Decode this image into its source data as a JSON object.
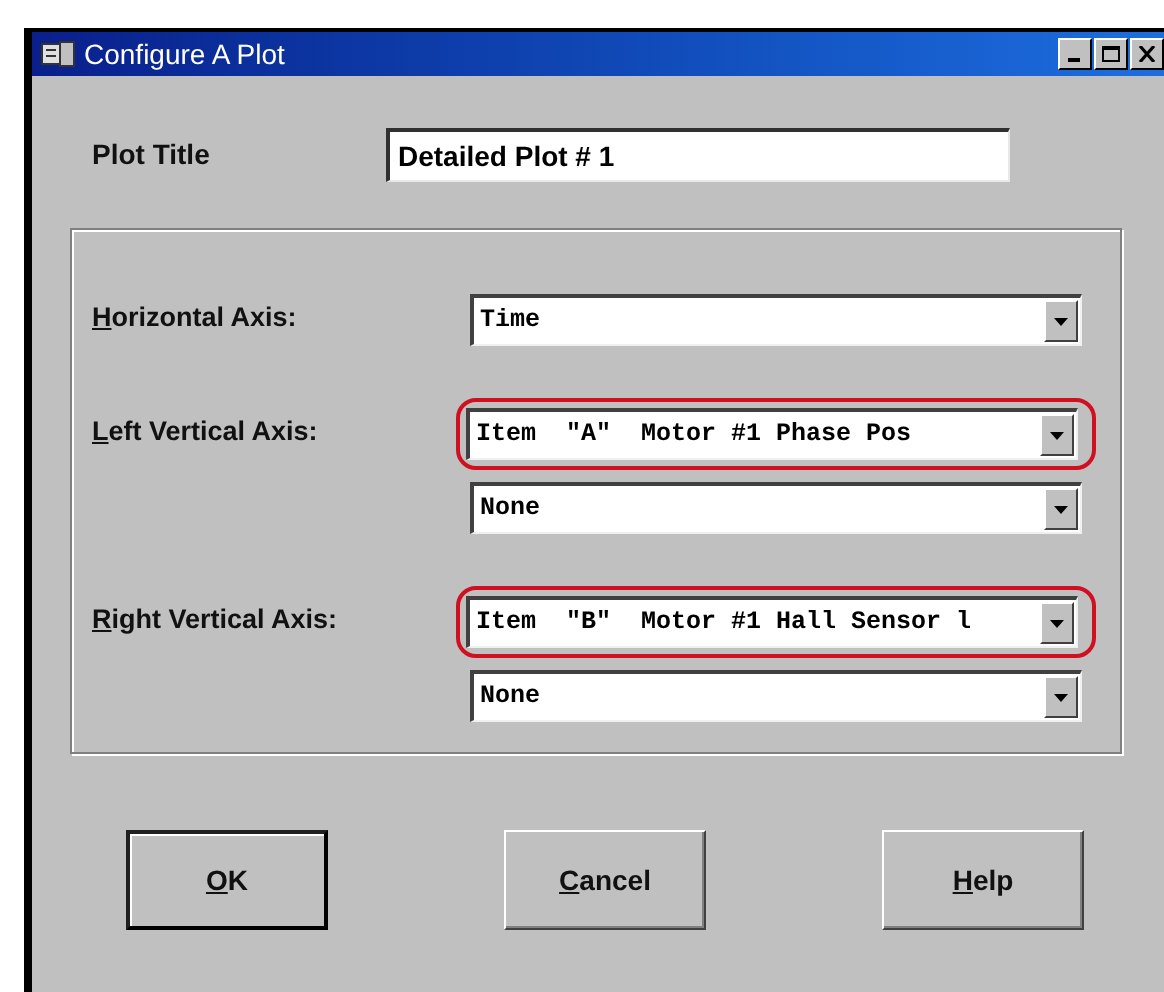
{
  "window": {
    "title": "Configure A Plot"
  },
  "plot_title": {
    "label": "Plot Title",
    "value": "Detailed Plot # 1"
  },
  "axes": [
    {
      "label": "Horizontal Axis:",
      "dropdowns": [
        {
          "value": "Time",
          "highlighted": false
        }
      ]
    },
    {
      "label": "Left Vertical Axis:",
      "dropdowns": [
        {
          "value": "Item  \"A\"  Motor #1 Phase Pos",
          "highlighted": true
        },
        {
          "value": "None",
          "highlighted": false
        }
      ]
    },
    {
      "label": "Right Vertical Axis:",
      "dropdowns": [
        {
          "value": "Item  \"B\"  Motor #1 Hall Sensor l",
          "highlighted": true
        },
        {
          "value": "None",
          "highlighted": false
        }
      ]
    }
  ],
  "buttons": [
    {
      "label": "OK",
      "default": true
    },
    {
      "label": "Cancel",
      "default": false
    },
    {
      "label": "Help",
      "default": false
    }
  ]
}
